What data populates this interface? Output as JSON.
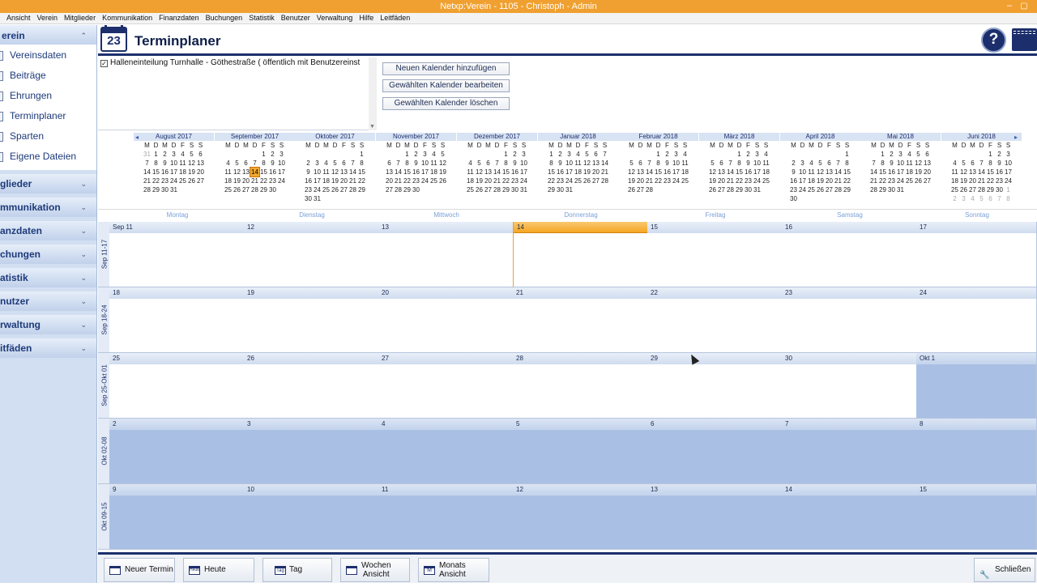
{
  "window": {
    "title": "Netxp:Verein - 1105 - Christoph - Admin",
    "min_glyph": "–",
    "max_glyph": "▢"
  },
  "menubar": [
    "Ansicht",
    "Verein",
    "Mitglieder",
    "Kommunikation",
    "Finanzdaten",
    "Buchungen",
    "Statistik",
    "Benutzer",
    "Verwaltung",
    "Hilfe",
    "Leitfäden"
  ],
  "sidebar": {
    "head": "erein",
    "items": [
      "Vereinsdaten",
      "Beiträge",
      "Ehrungen",
      "Terminplaner",
      "Sparten",
      "Eigene Dateien"
    ],
    "sections": [
      "glieder",
      "mmunikation",
      "anzdaten",
      "chungen",
      "atistik",
      "nutzer",
      "rwaltung",
      "itfäden"
    ],
    "chevron_up": "⌃",
    "chevron_down": "⌄"
  },
  "header": {
    "icon_number": "23",
    "title": "Terminplaner",
    "help_glyph": "?"
  },
  "calendar_list": [
    {
      "checked": true,
      "check_glyph": "✓",
      "label": "Halleneinteilung Turnhalle - Göthestraße ( öffentlich mit Benutzereinst"
    }
  ],
  "actions": {
    "add": "Neuen Kalender hinzufügen",
    "edit": "Gewählten Kalender bearbeiten",
    "delete": "Gewählten Kalender löschen"
  },
  "mini_nav": {
    "prev": "◂",
    "next": "▸"
  },
  "weekday_letters": [
    "M",
    "D",
    "M",
    "D",
    "F",
    "S",
    "S"
  ],
  "mini_months": [
    {
      "name": "August 2017",
      "weeks": [
        [
          "31",
          "1",
          "2",
          "3",
          "4",
          "5",
          "6"
        ],
        [
          "7",
          "8",
          "9",
          "10",
          "11",
          "12",
          "13"
        ],
        [
          "14",
          "15",
          "16",
          "17",
          "18",
          "19",
          "20"
        ],
        [
          "21",
          "22",
          "23",
          "24",
          "25",
          "26",
          "27"
        ],
        [
          "28",
          "29",
          "30",
          "31",
          "",
          "",
          ""
        ]
      ],
      "grey": [
        "31"
      ]
    },
    {
      "name": "September 2017",
      "weeks": [
        [
          "",
          "",
          "",
          "",
          "1",
          "2",
          "3"
        ],
        [
          "4",
          "5",
          "6",
          "7",
          "8",
          "9",
          "10"
        ],
        [
          "11",
          "12",
          "13",
          "14",
          "15",
          "16",
          "17"
        ],
        [
          "18",
          "19",
          "20",
          "21",
          "22",
          "23",
          "24"
        ],
        [
          "25",
          "26",
          "27",
          "28",
          "29",
          "30",
          ""
        ]
      ],
      "today": "14"
    },
    {
      "name": "Oktober 2017",
      "weeks": [
        [
          "",
          "",
          "",
          "",
          "",
          "",
          "1"
        ],
        [
          "2",
          "3",
          "4",
          "5",
          "6",
          "7",
          "8"
        ],
        [
          "9",
          "10",
          "11",
          "12",
          "13",
          "14",
          "15"
        ],
        [
          "16",
          "17",
          "18",
          "19",
          "20",
          "21",
          "22"
        ],
        [
          "23",
          "24",
          "25",
          "26",
          "27",
          "28",
          "29"
        ],
        [
          "30",
          "31",
          "",
          "",
          "",
          "",
          ""
        ]
      ]
    },
    {
      "name": "November 2017",
      "weeks": [
        [
          "",
          "",
          "1",
          "2",
          "3",
          "4",
          "5"
        ],
        [
          "6",
          "7",
          "8",
          "9",
          "10",
          "11",
          "12"
        ],
        [
          "13",
          "14",
          "15",
          "16",
          "17",
          "18",
          "19"
        ],
        [
          "20",
          "21",
          "22",
          "23",
          "24",
          "25",
          "26"
        ],
        [
          "27",
          "28",
          "29",
          "30",
          "",
          "",
          ""
        ]
      ]
    },
    {
      "name": "Dezember 2017",
      "weeks": [
        [
          "",
          "",
          "",
          "",
          "1",
          "2",
          "3"
        ],
        [
          "4",
          "5",
          "6",
          "7",
          "8",
          "9",
          "10"
        ],
        [
          "11",
          "12",
          "13",
          "14",
          "15",
          "16",
          "17"
        ],
        [
          "18",
          "19",
          "20",
          "21",
          "22",
          "23",
          "24"
        ],
        [
          "25",
          "26",
          "27",
          "28",
          "29",
          "30",
          "31"
        ]
      ]
    },
    {
      "name": "Januar 2018",
      "weeks": [
        [
          "1",
          "2",
          "3",
          "4",
          "5",
          "6",
          "7"
        ],
        [
          "8",
          "9",
          "10",
          "11",
          "12",
          "13",
          "14"
        ],
        [
          "15",
          "16",
          "17",
          "18",
          "19",
          "20",
          "21"
        ],
        [
          "22",
          "23",
          "24",
          "25",
          "26",
          "27",
          "28"
        ],
        [
          "29",
          "30",
          "31",
          "",
          "",
          "",
          ""
        ]
      ]
    },
    {
      "name": "Februar 2018",
      "weeks": [
        [
          "",
          "",
          "",
          "1",
          "2",
          "3",
          "4"
        ],
        [
          "5",
          "6",
          "7",
          "8",
          "9",
          "10",
          "11"
        ],
        [
          "12",
          "13",
          "14",
          "15",
          "16",
          "17",
          "18"
        ],
        [
          "19",
          "20",
          "21",
          "22",
          "23",
          "24",
          "25"
        ],
        [
          "26",
          "27",
          "28",
          "",
          "",
          "",
          ""
        ]
      ]
    },
    {
      "name": "März 2018",
      "weeks": [
        [
          "",
          "",
          "",
          "1",
          "2",
          "3",
          "4"
        ],
        [
          "5",
          "6",
          "7",
          "8",
          "9",
          "10",
          "11"
        ],
        [
          "12",
          "13",
          "14",
          "15",
          "16",
          "17",
          "18"
        ],
        [
          "19",
          "20",
          "21",
          "22",
          "23",
          "24",
          "25"
        ],
        [
          "26",
          "27",
          "28",
          "29",
          "30",
          "31",
          ""
        ]
      ]
    },
    {
      "name": "April 2018",
      "weeks": [
        [
          "",
          "",
          "",
          "",
          "",
          "",
          "1"
        ],
        [
          "2",
          "3",
          "4",
          "5",
          "6",
          "7",
          "8"
        ],
        [
          "9",
          "10",
          "11",
          "12",
          "13",
          "14",
          "15"
        ],
        [
          "16",
          "17",
          "18",
          "19",
          "20",
          "21",
          "22"
        ],
        [
          "23",
          "24",
          "25",
          "26",
          "27",
          "28",
          "29"
        ],
        [
          "30",
          "",
          "",
          "",
          "",
          "",
          ""
        ]
      ]
    },
    {
      "name": "Mai 2018",
      "weeks": [
        [
          "",
          "1",
          "2",
          "3",
          "4",
          "5",
          "6"
        ],
        [
          "7",
          "8",
          "9",
          "10",
          "11",
          "12",
          "13"
        ],
        [
          "14",
          "15",
          "16",
          "17",
          "18",
          "19",
          "20"
        ],
        [
          "21",
          "22",
          "23",
          "24",
          "25",
          "26",
          "27"
        ],
        [
          "28",
          "29",
          "30",
          "31",
          "",
          "",
          ""
        ]
      ]
    },
    {
      "name": "Juni 2018",
      "weeks": [
        [
          "",
          "",
          "",
          "",
          "1",
          "2",
          "3"
        ],
        [
          "4",
          "5",
          "6",
          "7",
          "8",
          "9",
          "10"
        ],
        [
          "11",
          "12",
          "13",
          "14",
          "15",
          "16",
          "17"
        ],
        [
          "18",
          "19",
          "20",
          "21",
          "22",
          "23",
          "24"
        ],
        [
          "25",
          "26",
          "27",
          "28",
          "29",
          "30",
          "1"
        ],
        [
          "2",
          "3",
          "4",
          "5",
          "6",
          "7",
          "8"
        ]
      ],
      "grey_tail": 8
    }
  ],
  "day_names": [
    "Montag",
    "Dienstag",
    "Mittwoch",
    "Donnerstag",
    "Freitag",
    "Samstag",
    "Sonntag"
  ],
  "weeks": [
    {
      "label": "Sep 11-17",
      "days": [
        "Sep 11",
        "12",
        "13",
        "14",
        "15",
        "16",
        "17"
      ],
      "out_from": 7,
      "today_index": 3
    },
    {
      "label": "Sep 18-24",
      "days": [
        "18",
        "19",
        "20",
        "21",
        "22",
        "23",
        "24"
      ],
      "out_from": 7
    },
    {
      "label": "Sep 25-Okt 01",
      "days": [
        "25",
        "26",
        "27",
        "28",
        "29",
        "30",
        "Okt 1"
      ],
      "out_from": 6
    },
    {
      "label": "Okt 02-08",
      "days": [
        "2",
        "3",
        "4",
        "5",
        "6",
        "7",
        "8"
      ],
      "out_from": 0
    },
    {
      "label": "Okt 09-15",
      "days": [
        "9",
        "10",
        "11",
        "12",
        "13",
        "14",
        "15"
      ],
      "out_from": 0
    }
  ],
  "bottom": {
    "new_event": "Neuer Termin",
    "today_label": "Heute",
    "today_icon_text": "Heute",
    "day_label": "Tag",
    "day_icon_text": "Tag",
    "week_line1": "Wochen",
    "week_line2": "Ansicht",
    "month_line1": "Monats",
    "month_line2": "Ansicht",
    "month_icon_text": "M",
    "close": "Schließen"
  },
  "colors": {
    "accent": "#f0a030",
    "navy": "#1c2f6c",
    "out_of_month": "#a9c0e4"
  }
}
